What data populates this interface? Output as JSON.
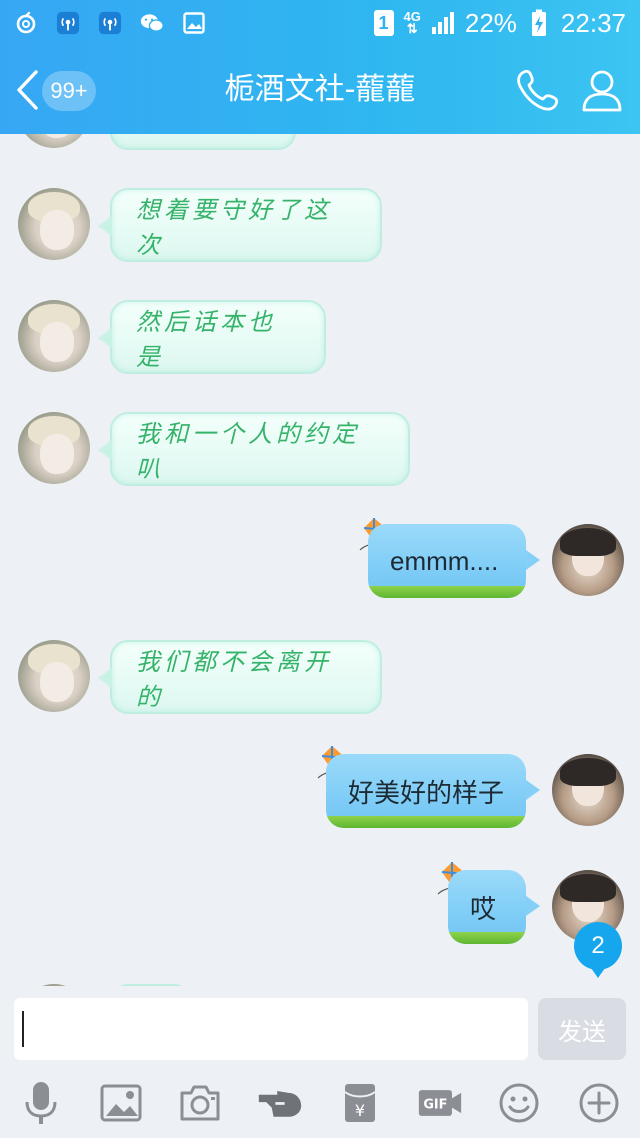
{
  "status_bar": {
    "sim_slot": "1",
    "network": "4G",
    "battery": "22%",
    "time": "22:37",
    "icons": [
      "netease-music-icon",
      "hotspot-icon",
      "hotspot-icon",
      "wechat-icon",
      "gallery-icon",
      "signal-icon",
      "battery-charging-icon"
    ]
  },
  "header": {
    "back_icon": "chevron-left-icon",
    "unread_badge": "99+",
    "title": "栀酒文社-蘢蘢",
    "call_icon": "phone-icon",
    "profile_icon": "user-icon"
  },
  "messages": [
    {
      "side": "in",
      "text": "想着要守好了这次"
    },
    {
      "side": "in",
      "text": "然后话本也是"
    },
    {
      "side": "in",
      "text": "我和一个人的约定叭"
    },
    {
      "side": "out",
      "text": "emmm...."
    },
    {
      "side": "in",
      "text": "我们都不会离开的"
    },
    {
      "side": "out",
      "text": "好美好的样子"
    },
    {
      "side": "out",
      "text": "哎"
    }
  ],
  "unread_new": "2",
  "input": {
    "value": "",
    "send_label": "发送"
  },
  "toolbar": {
    "icons": [
      "microphone-icon",
      "image-icon",
      "camera-icon",
      "poke-hand-icon",
      "red-packet-icon",
      "gif-icon",
      "emoji-icon",
      "plus-icon"
    ]
  },
  "colors": {
    "header_blue": "#2fb0f0",
    "incoming_text": "#36b36a",
    "outgoing_bubble": "#82cdf7",
    "unread_badge": "#16a6ee"
  }
}
